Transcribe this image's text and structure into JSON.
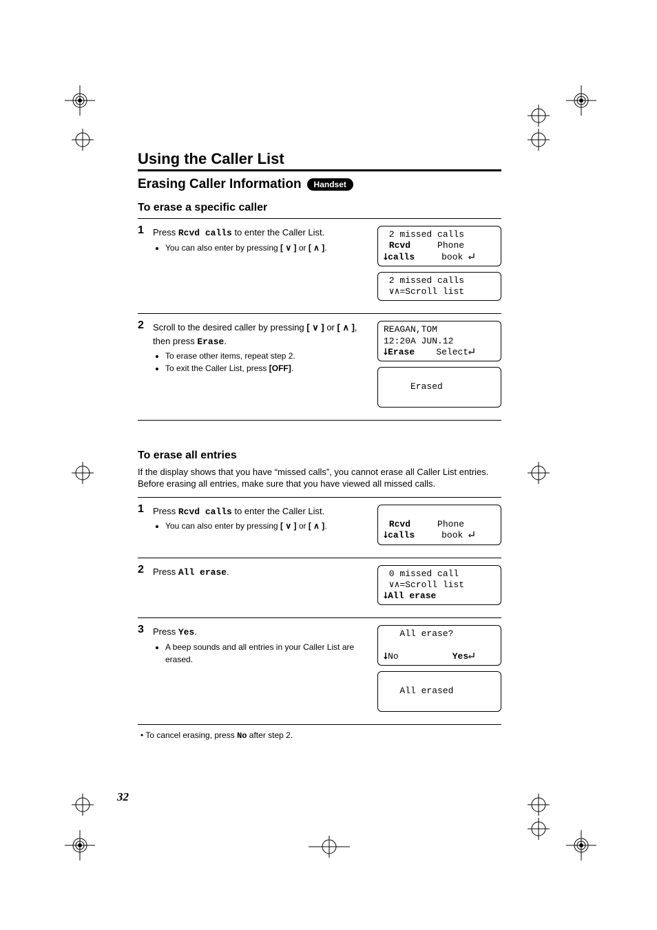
{
  "page_number": "32",
  "section_title": "Using the Caller List",
  "sub_heading": "Erasing Caller Information",
  "badge": "Handset",
  "h3_a": "To erase a specific caller",
  "steps_a": [
    {
      "num": "1",
      "body": "Press <span class=\"mono\">Rcvd&nbsp;calls</span> to enter the Caller List.",
      "bullets": [
        "You can also enter by pressing <b>[&nbsp;<span style=\"font-family:Arial\">&#8744;</span>&nbsp;]</b> or <b>[&nbsp;<span style=\"font-family:Arial\">&#8743;</span>&nbsp;]</b>."
      ],
      "screens": [
        "&nbsp;2 missed calls\n&nbsp;<span class=\"b\">Rcvd</span>&nbsp;&nbsp;&nbsp;&nbsp;&nbsp;Phone\n<span class=\"b\">&#x2B63;calls</span>&nbsp;&nbsp;&nbsp;&nbsp;&nbsp;book&nbsp;<svg class=\"arrow-enter\" width=\"10\" height=\"11\"><path d=\"M8 1 v6 h-5 M3 5 l-2 2 l2 2\" fill=\"none\" stroke=\"#000\" stroke-width=\"1.3\"/></svg>",
        "&nbsp;2 missed calls\n&nbsp;&#8744;&#8743;=Scroll list"
      ]
    },
    {
      "num": "2",
      "body": "Scroll to the desired caller by pressing <b>[&nbsp;<span style=\"font-family:Arial\">&#8744;</span>&nbsp;]</b> or <b>[&nbsp;<span style=\"font-family:Arial\">&#8743;</span>&nbsp;]</b>, then press <span class=\"mono\">Erase</span>.",
      "bullets": [
        "To erase other items, repeat step 2.",
        "To exit the Caller List, press <b>[OFF]</b>."
      ],
      "screens": [
        "REAGAN,TOM\n12:20A&nbsp;JUN.12\n<span class=\"b\">&#x2B63;Erase</span>&nbsp;&nbsp;&nbsp;&nbsp;Select<svg class=\"arrow-enter\" width=\"10\" height=\"11\"><path d=\"M8 1 v6 h-5 M3 5 l-2 2 l2 2\" fill=\"none\" stroke=\"#000\" stroke-width=\"1.3\"/></svg>",
        "\n&nbsp;&nbsp;&nbsp;&nbsp;&nbsp;Erased\n&nbsp;"
      ]
    }
  ],
  "h3_b": "To erase all entries",
  "intro_b": "If the display shows that you have “missed calls”, you cannot erase all Caller List entries. Before erasing all entries, make sure that you have viewed all missed calls.",
  "steps_b": [
    {
      "num": "1",
      "body": "Press <span class=\"mono\">Rcvd&nbsp;calls</span> to enter the Caller List.",
      "bullets": [
        "You can also enter by pressing <b>[&nbsp;<span style=\"font-family:Arial\">&#8744;</span>&nbsp;]</b> or <b>[&nbsp;<span style=\"font-family:Arial\">&#8743;</span>&nbsp;]</b>."
      ],
      "screens": [
        "\n&nbsp;<span class=\"b\">Rcvd</span>&nbsp;&nbsp;&nbsp;&nbsp;&nbsp;Phone\n<span class=\"b\">&#x2B63;calls</span>&nbsp;&nbsp;&nbsp;&nbsp;&nbsp;book&nbsp;<svg class=\"arrow-enter\" width=\"10\" height=\"11\"><path d=\"M8 1 v6 h-5 M3 5 l-2 2 l2 2\" fill=\"none\" stroke=\"#000\" stroke-width=\"1.3\"/></svg>"
      ]
    },
    {
      "num": "2",
      "body": "Press <span class=\"mono\">All&nbsp;erase</span>.",
      "bullets": [],
      "screens": [
        "&nbsp;0 missed call\n&nbsp;&#8744;&#8743;=Scroll list\n<span class=\"b\">&#x2B63;All erase</span>"
      ]
    },
    {
      "num": "3",
      "body": "Press <span class=\"mono\">Yes</span>.",
      "bullets": [
        "A beep sounds and all entries in your Caller List are erased."
      ],
      "screens": [
        "&nbsp;&nbsp;&nbsp;All erase?\n\n<span class=\"b\">&#x2B63;</span>No&nbsp;&nbsp;&nbsp;&nbsp;&nbsp;&nbsp;&nbsp;&nbsp;&nbsp;&nbsp;<span class=\"b\">Yes</span><svg class=\"arrow-enter\" width=\"10\" height=\"11\"><path d=\"M8 1 v6 h-5 M3 5 l-2 2 l2 2\" fill=\"none\" stroke=\"#000\" stroke-width=\"1.3\"/></svg>",
        "\n&nbsp;&nbsp;&nbsp;All erased\n&nbsp;"
      ]
    }
  ],
  "footnote_b": "• To cancel erasing, press <span class=\"mono\">No</span> after step 2."
}
